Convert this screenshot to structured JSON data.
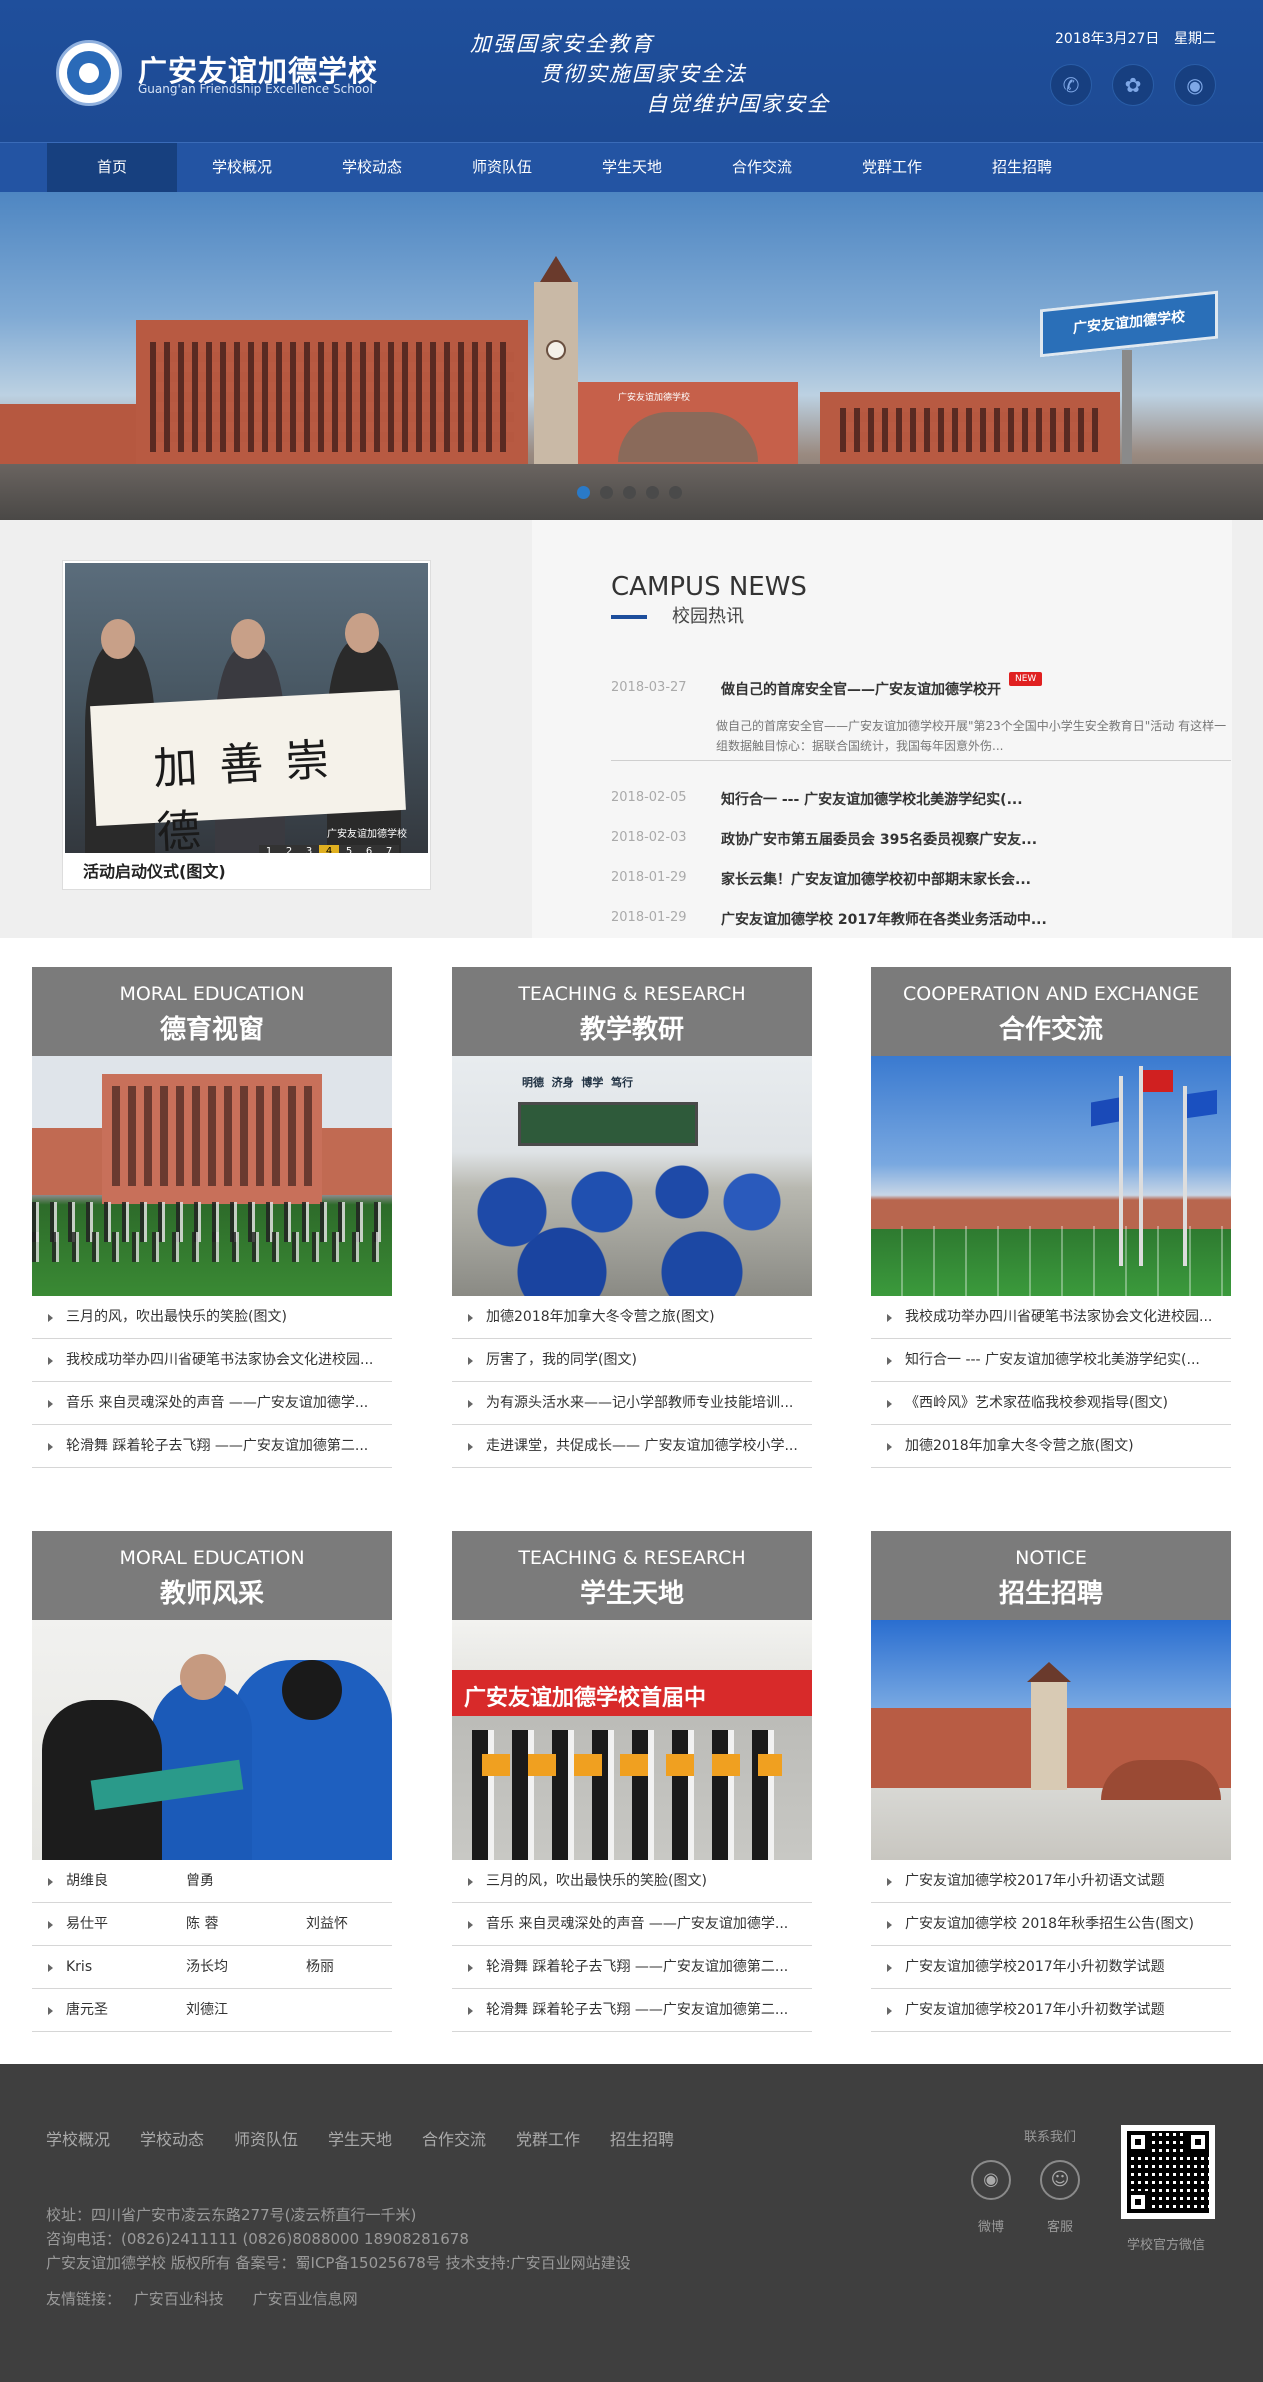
{
  "header": {
    "school_name_cn": "广安友谊加德学校",
    "school_name_en": "Guang'an Friendship Excellence School",
    "slogans": [
      "加强国家安全教育",
      "贯彻实施国家安全法",
      "自觉维护国家安全"
    ],
    "date": "2018年3月27日",
    "weekday": "星期二",
    "icons": [
      "phone-icon",
      "wechat-icon",
      "weibo-icon"
    ],
    "bg_color": "#1f4f9c"
  },
  "nav": {
    "items": [
      "首页",
      "学校概况",
      "学校动态",
      "师资队伍",
      "学生天地",
      "合作交流",
      "党群工作",
      "招生招聘"
    ],
    "active_index": 0
  },
  "banner": {
    "slide_count": 5,
    "active_slide": 1,
    "billboard_text": "广安友谊加德学校",
    "gate_text": "广安友谊加德学校"
  },
  "campus_news": {
    "photo_caption": "活动启动仪式(图文)",
    "photo_pages": [
      "1",
      "2",
      "3",
      "4",
      "5",
      "6",
      "7"
    ],
    "photo_active_page": "4",
    "photo_watermark": "广安友谊加德学校",
    "calligraphy": "加善崇德",
    "title_en": "CAMPUS NEWS",
    "title_cn": "校园热讯",
    "featured": {
      "date": "2018-03-27",
      "title": "做自己的首席安全官——广安友谊加德学校开",
      "badge": "NEW",
      "excerpt": "做自己的首席安全官——广安友谊加德学校开展\"第23个全国中小学生安全教育日\"活动 有这样一组数据触目惊心：据联合国统计，我国每年因意外伤..."
    },
    "items": [
      {
        "date": "2018-02-05",
        "title": "知行合一 --- 广安友谊加德学校北美游学纪实(..."
      },
      {
        "date": "2018-02-03",
        "title": "政协广安市第五届委员会 395名委员视察广安友..."
      },
      {
        "date": "2018-01-29",
        "title": "家长云集！广安友谊加德学校初中部期末家长会..."
      },
      {
        "date": "2018-01-29",
        "title": "广安友谊加德学校 2017年教师在各类业务活动中..."
      }
    ]
  },
  "cards": [
    {
      "en": "MORAL EDUCATION",
      "cn": "德育视窗",
      "items": [
        "三月的风，吹出最快乐的笑脸(图文)",
        "我校成功举办四川省硬笔书法家协会文化进校园...",
        "音乐 来自灵魂深处的声音 ——广安友谊加德学...",
        "轮滑舞 踩着轮子去飞翔 ——广安友谊加德第二..."
      ]
    },
    {
      "en": "TEACHING & RESEARCH",
      "cn": "教学教研",
      "items": [
        "加德2018年加拿大冬令营之旅(图文)",
        "厉害了，我的同学(图文)",
        "为有源头活水来——记小学部教师专业技能培训...",
        "走进课堂，共促成长—— 广安友谊加德学校小学..."
      ],
      "board_text": [
        "明德",
        "济身",
        "博学",
        "笃行"
      ]
    },
    {
      "en": "COOPERATION AND EXCHANGE",
      "cn": "合作交流",
      "items": [
        "我校成功举办四川省硬笔书法家协会文化进校园...",
        "知行合一 --- 广安友谊加德学校北美游学纪实(...",
        "《西岭风》艺术家莅临我校参观指导(图文)",
        "加德2018年加拿大冬令营之旅(图文)"
      ]
    },
    {
      "en": "MORAL EDUCATION",
      "cn": "教师风采",
      "teachers": [
        [
          "胡维良",
          "曾勇",
          ""
        ],
        [
          "易仕平",
          "陈 蓉",
          "刘益怀"
        ],
        [
          "Kris",
          "汤长均",
          "杨丽"
        ],
        [
          "唐元圣",
          "刘德江",
          ""
        ]
      ]
    },
    {
      "en": "TEACHING & RESEARCH",
      "cn": "学生天地",
      "items": [
        "三月的风，吹出最快乐的笑脸(图文)",
        "音乐 来自灵魂深处的声音 ——广安友谊加德学...",
        "轮滑舞 踩着轮子去飞翔 ——广安友谊加德第二...",
        "轮滑舞 踩着轮子去飞翔 ——广安友谊加德第二..."
      ],
      "banner_text": "广安友谊加德学校首届中"
    },
    {
      "en": "NOTICE",
      "cn": "招生招聘",
      "items": [
        "广安友谊加德学校2017年小升初语文试题",
        "广安友谊加德学校 2018年秋季招生公告(图文)",
        "广安友谊加德学校2017年小升初数学试题",
        "广安友谊加德学校2017年小升初数学试题"
      ]
    }
  ],
  "footer": {
    "nav": [
      "学校概况",
      "学校动态",
      "师资队伍",
      "学生天地",
      "合作交流",
      "党群工作",
      "招生招聘"
    ],
    "address": "校址：四川省广安市凌云东路277号(凌云桥直行一千米)",
    "phone": "咨询电话：(0826)2411111  (0826)8088000  18908281678",
    "copyright": "广安友谊加德学校 版权所有 备案号：蜀ICP备15025678号 技术支持:广安百业网站建设",
    "links_label": "友情链接：",
    "links": [
      "广安百业科技",
      "广安百业信息网"
    ],
    "contact_label": "联系我们",
    "weibo_label": "微博",
    "kefu_label": "客服",
    "qr_caption": "学校官方微信"
  }
}
